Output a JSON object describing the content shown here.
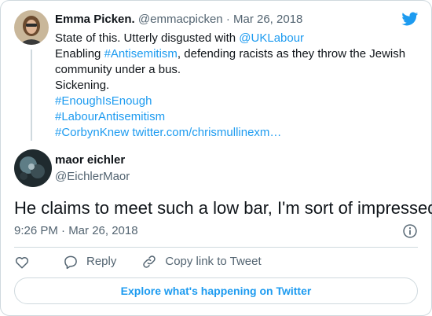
{
  "quoted_tweet": {
    "author_name": "Emma Picken.",
    "handle": "@emmacpicken",
    "separator": " · ",
    "date": "Mar 26, 2018",
    "line1_text": "State of this. Utterly disgusted with ",
    "line1_link": "@UKLabour",
    "line2_text": "Enabling ",
    "line2_link": "#Antisemitism",
    "line2_rest": ", defending racists as they throw the Jewish",
    "line3_text": "community under a bus.",
    "line4_text": "Sickening.",
    "hashtag1": "#EnoughIsEnough",
    "hashtag2": "#LabourAntisemitism",
    "hashtag3": "#CorbynKnew",
    "url": "twitter.com/chrismullinexm…"
  },
  "tweet": {
    "author_name": "maor eichler",
    "handle": "@EichlerMaor",
    "text": "He claims to meet such a low bar, I'm sort of impressed",
    "timestamp": "9:26 PM · Mar 26, 2018"
  },
  "actions": {
    "reply_label": "Reply",
    "copy_link_label": "Copy link to Tweet"
  },
  "explore_button": "Explore what's happening on Twitter",
  "colors": {
    "link": "#1d9bf0",
    "text": "#0f1419",
    "muted": "#536471",
    "border": "#cfd9de"
  }
}
